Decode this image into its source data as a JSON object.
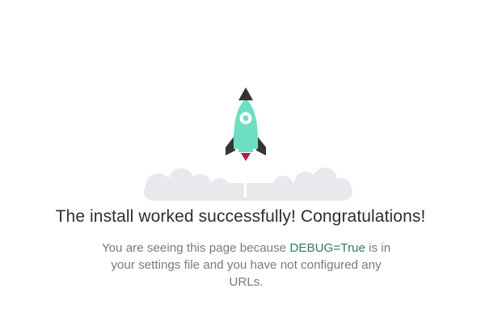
{
  "page": {
    "headline": "The install worked successfully! Congratulations!",
    "message": {
      "before": "You are seeing this page because ",
      "highlight": "DEBUG=True",
      "after": " is in your settings file and you have not configured any URLs."
    }
  },
  "illustration": {
    "icons": [
      "rocket-icon",
      "cloud-icon"
    ],
    "colors": {
      "rocket_body": "#6ddfc0",
      "rocket_dark": "#343434",
      "flame": "#b01d4a",
      "cloud": "#e8e9ec"
    }
  }
}
